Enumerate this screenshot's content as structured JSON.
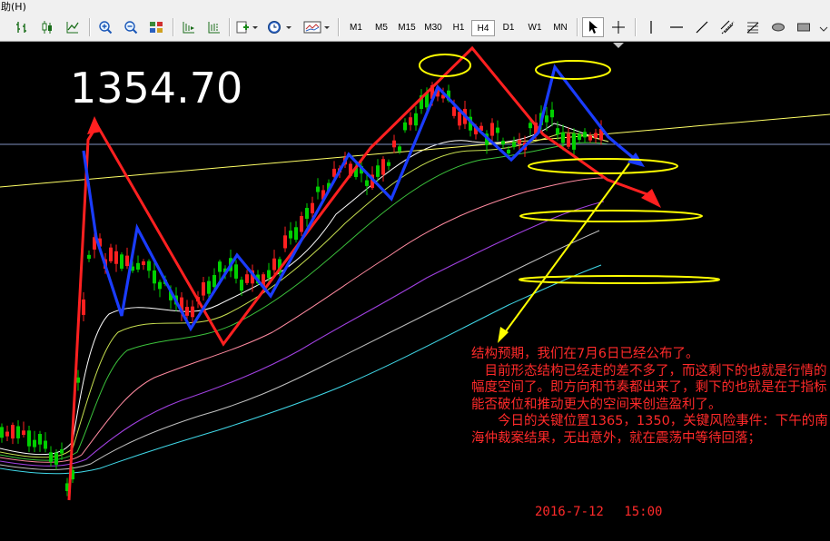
{
  "menu": {
    "help_label": "助(H)"
  },
  "toolbar": {
    "timeframes": [
      "M1",
      "M5",
      "M15",
      "M30",
      "H1",
      "H4",
      "D1",
      "W1",
      "MN"
    ],
    "active_timeframe": "H4"
  },
  "chart": {
    "price_label": "1354.70",
    "annotation": {
      "lines": [
        "结构预期，我们在7月6日已经公布了。",
        "　目前形态结构已经走的差不多了，而这剩下的也就是行情的幅度空间了。即方向和节奏都出来了，剩下的也就是在于指标能否破位和推动更大的空间来创造盈利了。",
        "　　今日的关键位置1365，1350，关键风险事件：下午的南海仲裁案结果，无出意外，就在震荡中等待回落；"
      ],
      "timestamp": "2016-7-12　 15:00"
    },
    "colors": {
      "annotation_text": "#ff2a2a",
      "bull_candle": "#ff2020",
      "bear_candle": "#00d000",
      "blue_path": "#1a3cff",
      "red_path": "#ff2020",
      "ellipse": "#ffff00",
      "trendline": "#ffff66"
    }
  }
}
